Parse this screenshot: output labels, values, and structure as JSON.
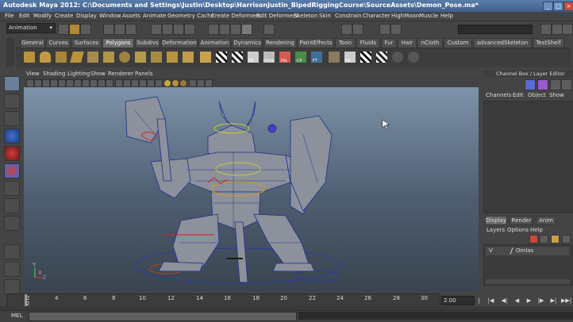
{
  "window": {
    "title": "Autodesk Maya 2012: C:\\Documents and Settings\\Justin\\Desktop\\HarrisonJustin_BipedRiggingCourse\\SourceAssets\\Demon_Pose.ma*",
    "min_glyph": "_",
    "max_glyph": "□",
    "close_glyph": "×"
  },
  "menubar": [
    "File",
    "Edit",
    "Modify",
    "Create",
    "Display",
    "Window",
    "Assets",
    "Animate",
    "Geometry Cache",
    "Create Deformers",
    "Edit Deformers",
    "Skeleton",
    "Skin",
    "Constrain",
    "Character",
    "HighMoon",
    "Muscle",
    "Help"
  ],
  "statusline": {
    "mode": "Animation",
    "mode_arrow": "▾"
  },
  "shelf": {
    "tabs": [
      "General",
      "Curves",
      "Surfaces",
      "Polygons",
      "Subdivs",
      "Deformation",
      "Animation",
      "Dynamics",
      "Rendering",
      "PaintEffects",
      "Toon",
      "Fluids",
      "Fur",
      "Hair",
      "nCloth",
      "Custom",
      "advancedSkeleton",
      "TestShelf"
    ],
    "active_tab": "Polygons",
    "icon_labels": [
      "FN",
      "Hshd",
      "His",
      "CP",
      "FT",
      "FN"
    ]
  },
  "viewport": {
    "menu": [
      "View",
      "Shading",
      "Lighting",
      "Show",
      "Renderer",
      "Panels"
    ],
    "axis_y": "Y",
    "axis_x": "X",
    "axis_z": "Z"
  },
  "channel_box": {
    "title": "Channel Box / Layer Editor",
    "menu": [
      "Channels",
      "Edit",
      "Object",
      "Show"
    ]
  },
  "layer_editor": {
    "tabs": [
      "Display",
      "Render",
      "Anim"
    ],
    "active_tab": "Display",
    "menu": [
      "Layers",
      "Options",
      "Help"
    ],
    "layers": [
      {
        "visible": "V",
        "name": "Omlas"
      }
    ]
  },
  "time_slider": {
    "frames": [
      "2",
      "4",
      "6",
      "8",
      "10",
      "12",
      "14",
      "16",
      "18",
      "20",
      "22",
      "24",
      "26",
      "28",
      "30"
    ],
    "range_start_label": "2",
    "current_frame": "2.00",
    "playback_buttons": [
      "|◀◀",
      "|◀",
      "◀|",
      "◀",
      "▶",
      "|▶",
      "▶|",
      "▶▶|"
    ]
  },
  "command_line": {
    "label": "MEL"
  },
  "colors": {
    "titlebar": "#3d5f8c",
    "viewport_top": "#7d92a9",
    "viewport_bottom": "#3a4450",
    "mesh_fill": "#8a8f99",
    "wire": "#2a3a9a"
  }
}
